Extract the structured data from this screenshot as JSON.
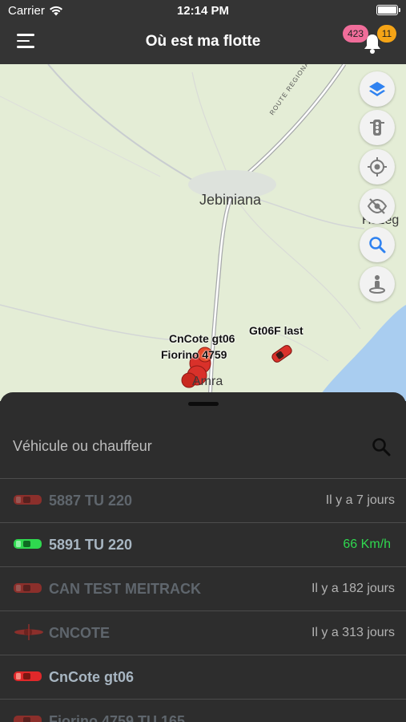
{
  "status_bar": {
    "carrier": "Carrier",
    "time": "12:14 PM"
  },
  "nav": {
    "title": "Où est ma flotte",
    "badge_alerts": "423",
    "badge_notifications": "11"
  },
  "map": {
    "city_labels": [
      "Jebiniana",
      "Hazeg",
      "Amra"
    ],
    "road_label": "ROUTE REGIONALE SFAX",
    "vehicle_labels": [
      "CnCote gt06",
      "Fiorino 4759",
      "Gt06F last"
    ],
    "controls": [
      "layers-icon",
      "traffic-light-icon",
      "locate-icon",
      "hide-icon",
      "search-icon",
      "street-view-icon"
    ]
  },
  "search": {
    "placeholder": "Véhicule ou chauffeur"
  },
  "vehicles": [
    {
      "name": "5887 TU 220",
      "status": "Il y a 7 jours",
      "state": "offline",
      "color": "#d9312a"
    },
    {
      "name": "5891 TU 220",
      "status": "66 Km/h",
      "state": "moving",
      "color": "#2fd84f"
    },
    {
      "name": "CAN TEST MEITRACK",
      "status": "Il y a 182 jours",
      "state": "offline",
      "color": "#d9312a"
    },
    {
      "name": "CNCOTE",
      "status": "Il y a 313 jours",
      "state": "offline",
      "color": "#d9312a"
    },
    {
      "name": "CnCote gt06",
      "status": "",
      "state": "stopped",
      "color": "#e0282a"
    },
    {
      "name": "Fiorino 4759 TU 165",
      "status": "",
      "state": "offline",
      "color": "#d9312a"
    }
  ],
  "colors": {
    "header_bg": "#343434",
    "sheet_bg": "#2d2d2d",
    "map_bg": "#e4edd6",
    "water": "#a9cdf0",
    "moving": "#2fd84f",
    "control_blue": "#2f82f0"
  }
}
